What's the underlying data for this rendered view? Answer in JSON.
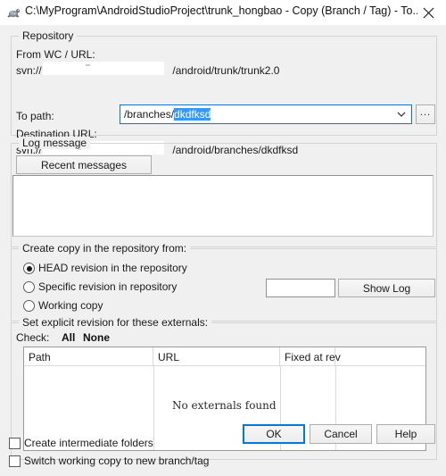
{
  "window": {
    "title": "C:\\MyProgram\\AndroidStudioProject\\trunk_hongbao - Copy (Branch / Tag) - To...",
    "icon": "tortoisesvn-turtle-icon",
    "close_label": "close-icon"
  },
  "repository": {
    "group_label": "Repository",
    "from_label": "From WC / URL:",
    "from_url_prefix": "svn://",
    "from_url_suffix": "/android/trunk/trunk2.0",
    "to_path_label": "To path:",
    "to_path_value_prefix": "/branches/",
    "to_path_value_selected": "dkdfksd",
    "browse_label": "...",
    "destination_label": "Destination URL:",
    "dest_url_prefix": "svn://",
    "dest_url_suffix": "/android/branches/dkdfksd"
  },
  "log_message": {
    "group_label": "Log message",
    "recent_messages_label": "Recent messages",
    "message_value": "",
    "message_placeholder": ""
  },
  "copy_from": {
    "group_label": "Create copy in the repository from:",
    "options": [
      {
        "label": "HEAD revision in the repository",
        "selected": true
      },
      {
        "label": "Specific revision in repository",
        "selected": false
      },
      {
        "label": "Working copy",
        "selected": false
      }
    ],
    "revision_value": "",
    "show_log_label": "Show Log"
  },
  "externals": {
    "group_label": "Set explicit revision for these externals:",
    "check_label": "Check:",
    "check_all_label": "All",
    "check_none_label": "None",
    "columns": [
      "Path",
      "URL",
      "Fixed at rev"
    ],
    "empty_message": "No externals found",
    "rows": []
  },
  "footer": {
    "checkboxes": [
      {
        "label": "Create intermediate folders",
        "checked": false
      },
      {
        "label": "Switch working copy to new branch/tag",
        "checked": false
      }
    ],
    "ok_label": "OK",
    "cancel_label": "Cancel",
    "help_label": "Help"
  },
  "colors": {
    "accent": "#0078d7",
    "selection": "#3399ff",
    "dialog_bg": "#f0f0f0",
    "field_bg": "#ffffff"
  }
}
